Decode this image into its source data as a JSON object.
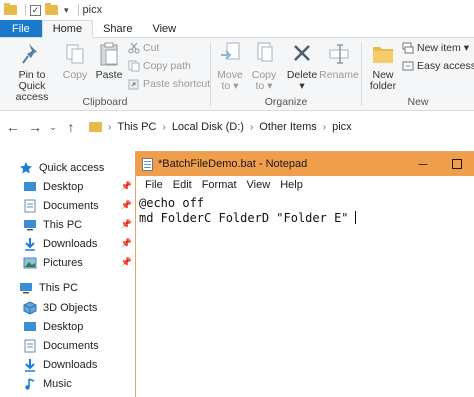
{
  "window": {
    "title": "picx"
  },
  "ribbon_tabs": [
    "File",
    "Home",
    "Share",
    "View"
  ],
  "clipboard": {
    "pin_label_1": "Pin to Quick",
    "pin_label_2": "access",
    "copy": "Copy",
    "paste": "Paste",
    "cut": "Cut",
    "copy_path": "Copy path",
    "paste_shortcut": "Paste shortcut",
    "group_label": "Clipboard"
  },
  "organize": {
    "move_to": "Move",
    "move_to_2": "to",
    "copy_to": "Copy",
    "copy_to_2": "to",
    "delete": "Delete",
    "rename": "Rename",
    "group_label": "Organize"
  },
  "new": {
    "new_folder_1": "New",
    "new_folder_2": "folder",
    "new_item": "New item",
    "easy_access": "Easy access",
    "group_label": "New"
  },
  "address": {
    "crumbs": [
      "This PC",
      "Local Disk (D:)",
      "Other Items",
      "picx"
    ]
  },
  "nav": {
    "items": [
      {
        "label": "Quick access",
        "icon": "star-icon"
      },
      {
        "label": "Desktop",
        "icon": "desktop-icon"
      },
      {
        "label": "Documents",
        "icon": "documents-icon"
      },
      {
        "label": "This PC",
        "icon": "pc-icon"
      },
      {
        "label": "Downloads",
        "icon": "download-icon"
      },
      {
        "label": "Pictures",
        "icon": "pictures-icon"
      },
      {
        "label": "This PC",
        "icon": "pc-icon"
      },
      {
        "label": "3D Objects",
        "icon": "cube-icon"
      },
      {
        "label": "Desktop",
        "icon": "desktop-icon"
      },
      {
        "label": "Documents",
        "icon": "documents-icon"
      },
      {
        "label": "Downloads",
        "icon": "download-icon"
      },
      {
        "label": "Music",
        "icon": "music-icon"
      }
    ]
  },
  "notepad": {
    "title": "*BatchFileDemo.bat - Notepad",
    "menu": [
      "File",
      "Edit",
      "Format",
      "View",
      "Help"
    ],
    "lines": [
      "@echo off",
      "md FolderC FolderD \"Folder E\""
    ],
    "accent": "#ef9e4b"
  }
}
